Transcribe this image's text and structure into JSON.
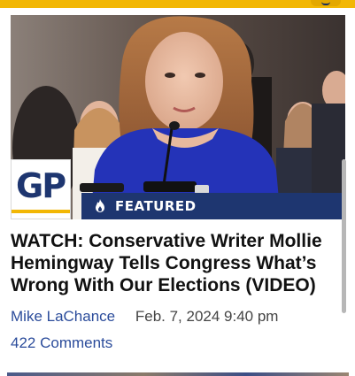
{
  "article": {
    "image_badge": "FEATURED",
    "logo_text": "GP",
    "headline": "WATCH: Conservative Writer Mollie Hemingway Tells Congress What’s Wrong With Our Elections (VIDEO)",
    "author": "Mike LaChance",
    "date": "Feb. 7, 2024 9:40 pm",
    "comments": "422 Comments"
  },
  "colors": {
    "brand_navy": "#1e3670",
    "brand_yellow": "#f2b705",
    "link_blue": "#2b4c9b"
  },
  "icons": {
    "featured": "flame-icon"
  }
}
